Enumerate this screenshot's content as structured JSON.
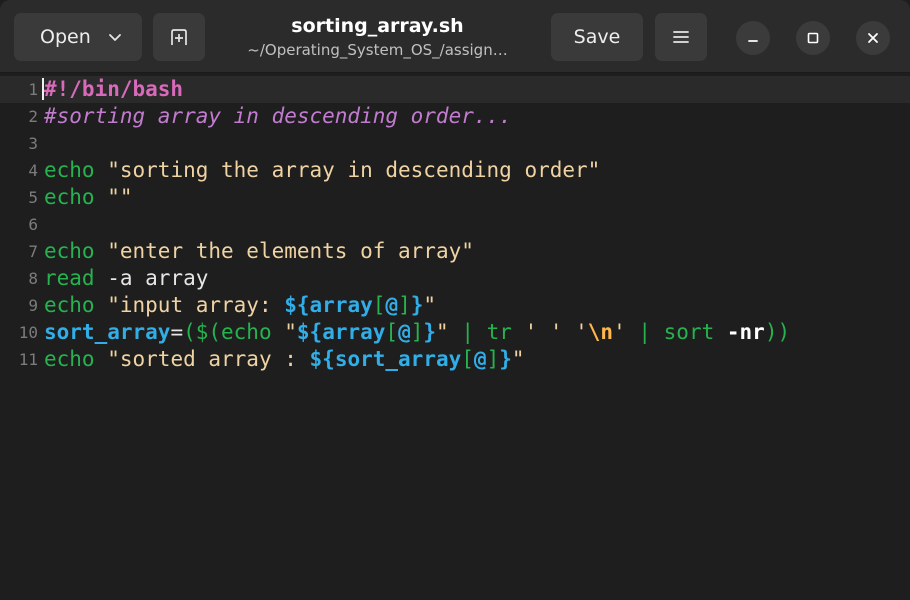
{
  "window": {
    "title": "sorting_array.sh",
    "subtitle": "~/Operating_System_OS_/assign…"
  },
  "header": {
    "open_label": "Open",
    "save_label": "Save"
  },
  "icons": {
    "open_dropdown": "chevron-down-icon",
    "new_tab": "new-tab-icon",
    "menu": "hamburger-menu-icon",
    "minimize": "minimize-icon",
    "maximize": "maximize-icon",
    "close": "close-icon"
  },
  "colors": {
    "background": "#1e1e1e",
    "headerbar": "#2b2b2b",
    "keyword": "#26b34f",
    "string": "#f0d3a3",
    "variable": "#31aee8",
    "comment": "#c27ccf",
    "shebang": "#d76ab9"
  },
  "editor": {
    "line_numbers": [
      "1",
      "2",
      "3",
      "4",
      "5",
      "6",
      "7",
      "8",
      "9",
      "10",
      "11"
    ],
    "lines": [
      [
        {
          "t": "shebang",
          "v": "#!/bin/bash"
        }
      ],
      [
        {
          "t": "comment",
          "v": "#sorting array in descending order..."
        }
      ],
      [],
      [
        {
          "t": "kw",
          "v": "echo"
        },
        {
          "t": "plain",
          "v": " "
        },
        {
          "t": "str",
          "v": "\"sorting the array in descending order\""
        }
      ],
      [
        {
          "t": "kw",
          "v": "echo"
        },
        {
          "t": "plain",
          "v": " "
        },
        {
          "t": "str",
          "v": "\"\""
        }
      ],
      [],
      [
        {
          "t": "kw",
          "v": "echo"
        },
        {
          "t": "plain",
          "v": " "
        },
        {
          "t": "str",
          "v": "\"enter the elements of array\""
        }
      ],
      [
        {
          "t": "kw",
          "v": "read"
        },
        {
          "t": "plain",
          "v": " -a array"
        }
      ],
      [
        {
          "t": "kw",
          "v": "echo"
        },
        {
          "t": "plain",
          "v": " "
        },
        {
          "t": "str",
          "v": "\"input array: "
        },
        {
          "t": "var",
          "v": "${array"
        },
        {
          "t": "op",
          "v": "["
        },
        {
          "t": "var",
          "v": "@"
        },
        {
          "t": "op",
          "v": "]"
        },
        {
          "t": "var",
          "v": "}"
        },
        {
          "t": "str",
          "v": "\""
        }
      ],
      [
        {
          "t": "var",
          "v": "sort_array"
        },
        {
          "t": "plain",
          "v": "="
        },
        {
          "t": "op",
          "v": "($(echo "
        },
        {
          "t": "str",
          "v": "\""
        },
        {
          "t": "var",
          "v": "${array"
        },
        {
          "t": "op",
          "v": "["
        },
        {
          "t": "var",
          "v": "@"
        },
        {
          "t": "op",
          "v": "]"
        },
        {
          "t": "var",
          "v": "}"
        },
        {
          "t": "str",
          "v": "\""
        },
        {
          "t": "op",
          "v": " | tr "
        },
        {
          "t": "str",
          "v": "' ' '"
        },
        {
          "t": "esc",
          "v": "\\n"
        },
        {
          "t": "str",
          "v": "'"
        },
        {
          "t": "op",
          "v": " | sort "
        },
        {
          "t": "flag",
          "v": "-nr"
        },
        {
          "t": "op",
          "v": "))"
        }
      ],
      [
        {
          "t": "kw",
          "v": "echo"
        },
        {
          "t": "plain",
          "v": " "
        },
        {
          "t": "str",
          "v": "\"sorted array : "
        },
        {
          "t": "var",
          "v": "${sort_array"
        },
        {
          "t": "op",
          "v": "["
        },
        {
          "t": "var",
          "v": "@"
        },
        {
          "t": "op",
          "v": "]"
        },
        {
          "t": "var",
          "v": "}"
        },
        {
          "t": "str",
          "v": "\""
        }
      ]
    ]
  }
}
